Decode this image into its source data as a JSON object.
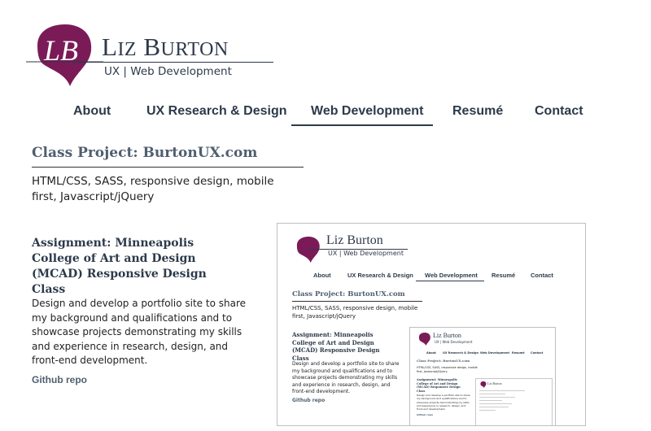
{
  "brand": {
    "name_first_initial": "L",
    "name_first_rest": "IZ",
    "name_last_initial": "B",
    "name_last_rest": "URTON",
    "subtitle": "UX | Web Development",
    "monogram": "LB",
    "accent_color": "#7a1b57",
    "text_color": "#2d3a4a"
  },
  "nav": {
    "items": [
      {
        "label": "About"
      },
      {
        "label": "UX Research & Design"
      },
      {
        "label": "Web Development",
        "active": true
      },
      {
        "label": "Resumé"
      },
      {
        "label": "Contact"
      }
    ]
  },
  "main": {
    "project_title": "Class Project: BurtonUX.com",
    "tags": "HTML/CSS, SASS, responsive design, mobile first, Javascript/jQuery",
    "assignment_title": "Assignment: Minneapolis College of Art and Design (MCAD) Responsive Design Class",
    "assignment_desc": "Design and develop a portfolio site to share my background and qualifications and to showcase projects demonstrating my skills and experience in research, design, and front-end development.",
    "repo_link": "Github repo"
  },
  "screenshot": {
    "name": "Liz Burton",
    "subtitle": "UX | Web Development",
    "nav": [
      "About",
      "UX Research & Design",
      "Web Development",
      "Resumé",
      "Contact"
    ],
    "project_title": "Class Project: BurtonUX.com",
    "tags": "HTML/CSS, SASS, responsive design, mobile first, Javascript/jQuery",
    "assignment_title": "Assignment: Minneapolis College of Art and Design (MCAD) Responsive Design Class",
    "assignment_desc": "Design and develop a portfolio site to share my background and qualifications and to showcase projects demonstrating my skills and experience in research, design, and front-end development.",
    "repo_link": "Github repo"
  }
}
